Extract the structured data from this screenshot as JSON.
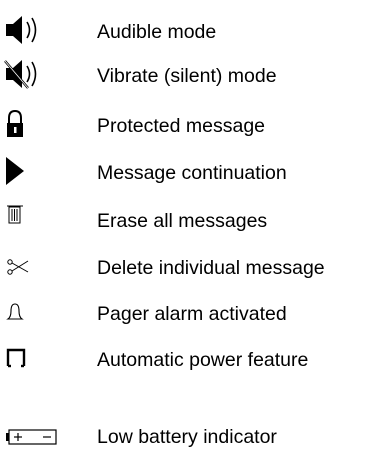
{
  "legend": {
    "items": [
      {
        "icon": "speaker-sound-icon",
        "label": "Audible mode"
      },
      {
        "icon": "speaker-muted-icon",
        "label": "Vibrate (silent) mode"
      },
      {
        "icon": "padlock-icon",
        "label": "Protected message"
      },
      {
        "icon": "play-triangle-icon",
        "label": "Message continuation"
      },
      {
        "icon": "trash-can-icon",
        "label": "Erase all messages"
      },
      {
        "icon": "scissors-icon",
        "label": "Delete individual message"
      },
      {
        "icon": "bell-icon",
        "label": "Pager alarm activated"
      },
      {
        "icon": "bracket-icon",
        "label": "Automatic power feature"
      },
      {
        "icon": "battery-icon",
        "label": "Low battery indicator"
      }
    ]
  }
}
